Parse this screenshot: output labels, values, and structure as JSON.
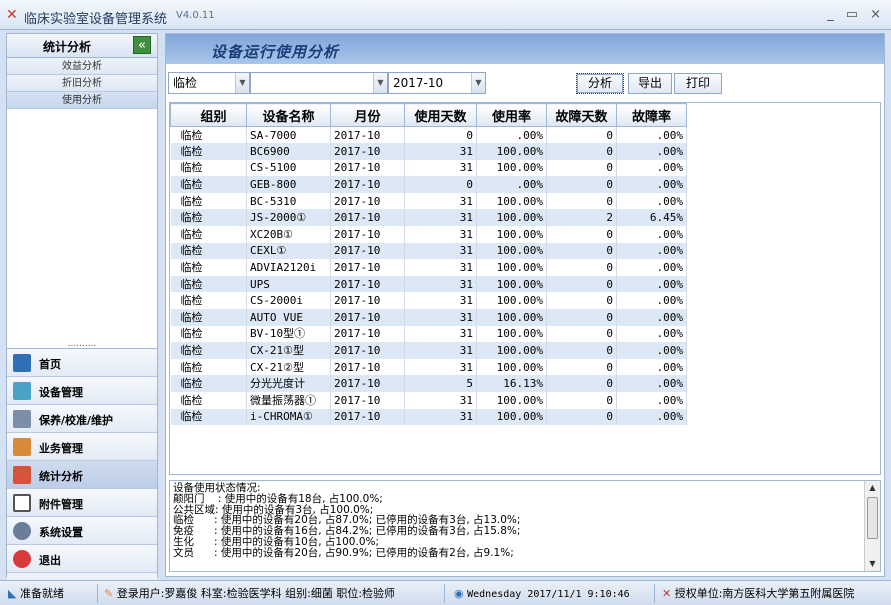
{
  "window": {
    "title": "临床实验室设备管理系统",
    "version": "V4.0.11",
    "controls": [
      "_",
      "▭",
      "×"
    ]
  },
  "sidebar": {
    "section_title": "统计分析",
    "collapse_icon": "double-chevron-left-icon",
    "sub_items": [
      {
        "label": "效益分析",
        "active": false
      },
      {
        "label": "折旧分析",
        "active": false
      },
      {
        "label": "使用分析",
        "active": true
      }
    ],
    "dots": "..........",
    "nav": [
      {
        "label": "首页",
        "icon": "home-icon",
        "color": "#2f6fb7"
      },
      {
        "label": "设备管理",
        "icon": "device-icon",
        "color": "#4aa3c7"
      },
      {
        "label": "保养/校准/维护",
        "icon": "maintenance-icon",
        "color": "#7d8ea8"
      },
      {
        "label": "业务管理",
        "icon": "bar-chart-icon",
        "color": "#d9893a"
      },
      {
        "label": "统计分析",
        "icon": "statistics-icon",
        "color": "#d9533a",
        "active": true
      },
      {
        "label": "附件管理",
        "icon": "attachment-icon",
        "color": "#555555"
      },
      {
        "label": "系统设置",
        "icon": "settings-icon",
        "color": "#6b7e99"
      },
      {
        "label": "退出",
        "icon": "power-icon",
        "color": "#d93a3a"
      }
    ],
    "more": "»"
  },
  "main": {
    "title": "设备运行使用分析",
    "filters": {
      "group": "临检",
      "device": "",
      "month": "2017-10"
    },
    "buttons": {
      "analyze": "分析",
      "export": "导出",
      "print": "打印"
    },
    "table": {
      "headers": [
        "组别",
        "设备名称",
        "月份",
        "使用天数",
        "使用率",
        "故障天数",
        "故障率"
      ],
      "rows": [
        [
          "临检",
          "SA-7000",
          "2017-10",
          "0",
          ".00%",
          "0",
          ".00%"
        ],
        [
          "临检",
          "BC6900",
          "2017-10",
          "31",
          "100.00%",
          "0",
          ".00%"
        ],
        [
          "临检",
          "CS-5100",
          "2017-10",
          "31",
          "100.00%",
          "0",
          ".00%"
        ],
        [
          "临检",
          "GEB-800",
          "2017-10",
          "0",
          ".00%",
          "0",
          ".00%"
        ],
        [
          "临检",
          "BC-5310",
          "2017-10",
          "31",
          "100.00%",
          "0",
          ".00%"
        ],
        [
          "临检",
          "JS-2000①",
          "2017-10",
          "31",
          "100.00%",
          "2",
          "6.45%"
        ],
        [
          "临检",
          "XC20B①",
          "2017-10",
          "31",
          "100.00%",
          "0",
          ".00%"
        ],
        [
          "临检",
          "CEXL①",
          "2017-10",
          "31",
          "100.00%",
          "0",
          ".00%"
        ],
        [
          "临检",
          "ADVIA2120i",
          "2017-10",
          "31",
          "100.00%",
          "0",
          ".00%"
        ],
        [
          "临检",
          "UPS",
          "2017-10",
          "31",
          "100.00%",
          "0",
          ".00%"
        ],
        [
          "临检",
          "CS-2000i",
          "2017-10",
          "31",
          "100.00%",
          "0",
          ".00%"
        ],
        [
          "临检",
          "AUTO VUE",
          "2017-10",
          "31",
          "100.00%",
          "0",
          ".00%"
        ],
        [
          "临检",
          "BV-10型①",
          "2017-10",
          "31",
          "100.00%",
          "0",
          ".00%"
        ],
        [
          "临检",
          "CX-21①型",
          "2017-10",
          "31",
          "100.00%",
          "0",
          ".00%"
        ],
        [
          "临检",
          "CX-21②型",
          "2017-10",
          "31",
          "100.00%",
          "0",
          ".00%"
        ],
        [
          "临检",
          "分光光度计",
          "2017-10",
          "5",
          "16.13%",
          "0",
          ".00%"
        ],
        [
          "临检",
          "微量振荡器①",
          "2017-10",
          "31",
          "100.00%",
          "0",
          ".00%"
        ],
        [
          "临检",
          "i-CHROMA①",
          "2017-10",
          "31",
          "100.00%",
          "0",
          ".00%"
        ]
      ]
    },
    "status_text": "设备使用状态情况:\n颠阳门    : 使用中的设备有18台, 占100.0%;\n公共区域: 使用中的设备有3台, 占100.0%;\n临检      : 使用中的设备有20台, 占87.0%; 已停用的设备有3台, 占13.0%;\n免疫      : 使用中的设备有16台, 占84.2%; 已停用的设备有3台, 占15.8%;\n生化      : 使用中的设备有10台, 占100.0%;\n文员      : 使用中的设备有20台, 占90.9%; 已停用的设备有2台, 占9.1%;"
  },
  "statusbar": {
    "ready": "准备就绪",
    "user": "登录用户:罗嘉俊  科室:检验医学科  组别:细菌  职位:检验师",
    "datetime": "Wednesday 2017/11/1 9:10:46",
    "org": "授权单位:南方医科大学第五附属医院"
  }
}
